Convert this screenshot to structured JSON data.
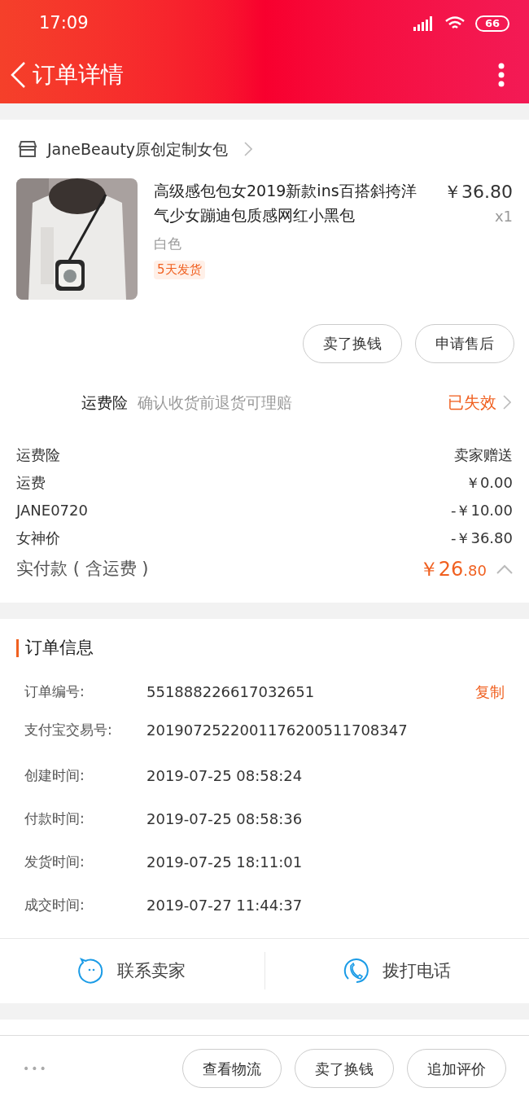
{
  "status_bar": {
    "time": "17:09",
    "battery": "66"
  },
  "header": {
    "title": "订单详情"
  },
  "shop": {
    "name": "JaneBeauty原创定制女包"
  },
  "item": {
    "title": "高级感包包女2019新款ins百搭斜挎洋气少女蹦迪包质感网红小黑包",
    "price": "￥36.80",
    "quantity": "x1",
    "variant": "白色",
    "tag": "5天发货"
  },
  "item_buttons": [
    "卖了换钱",
    "申请售后"
  ],
  "insurance": {
    "label": "运费险",
    "description": "确认收货前退货可理赔",
    "status": "已失效"
  },
  "price_rows": [
    {
      "label": "运费险",
      "value": "卖家赠送"
    },
    {
      "label": "运费",
      "value": "￥0.00"
    },
    {
      "label": "JANE0720",
      "value": "-￥10.00"
    },
    {
      "label": "女神价",
      "value": "-￥36.80"
    }
  ],
  "total": {
    "label": "实付款 ( 含运费 )",
    "amount_main": "￥26",
    "amount_cents": ".80",
    "expanded": true
  },
  "order_info": {
    "title": "订单信息",
    "rows": [
      {
        "label": "订单编号:",
        "value": "551888226617032651",
        "action": "复制"
      },
      {
        "label": "支付宝交易号:",
        "value": "2019072522001176200511708347"
      },
      {
        "label": "创建时间:",
        "value": "2019-07-25 08:58:24"
      },
      {
        "label": "付款时间:",
        "value": "2019-07-25 08:58:36"
      },
      {
        "label": "发货时间:",
        "value": "2019-07-25 18:11:01"
      },
      {
        "label": "成交时间:",
        "value": "2019-07-27 11:44:37"
      }
    ]
  },
  "contact": [
    {
      "kind": "chat",
      "label": "联系卖家"
    },
    {
      "kind": "phone",
      "label": "拨打电话"
    }
  ],
  "bottom_bar": {
    "more": "•••",
    "buttons": [
      "查看物流",
      "卖了换钱",
      "追加评价"
    ]
  }
}
